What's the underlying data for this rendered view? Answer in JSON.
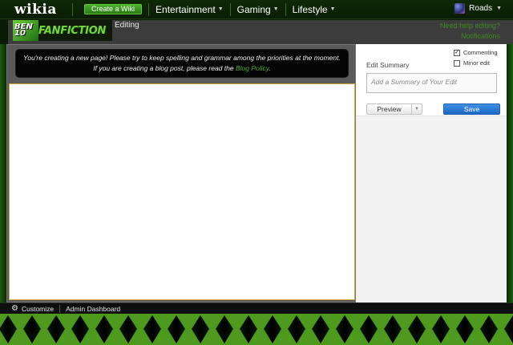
{
  "global_nav": {
    "logo": "wikia",
    "create_wiki": "Create a Wiki",
    "hubs": [
      {
        "label": "Entertainment"
      },
      {
        "label": "Gaming"
      },
      {
        "label": "Lifestyle"
      }
    ],
    "user": {
      "name": "Roads"
    }
  },
  "wiki_header": {
    "wordmark_badge": "BEN 10",
    "wordmark_text": "FANFICTION",
    "page_state": "Editing",
    "help_link": "Need help editing?",
    "notifications_link": "Notifications"
  },
  "editor": {
    "notice_text": "You're creating a new page! Please try to keep spelling and grammar among the priorities at the moment. If you are creating a blog post, please read the ",
    "notice_link": "Blog Policy",
    "notice_end": "."
  },
  "rail": {
    "commenting_label": "Commenting",
    "commenting_checked": true,
    "minor_edit_label": "Minor edit",
    "minor_edit_checked": false,
    "edit_summary_label": "Edit Summary",
    "summary_placeholder": "Add a Summary of Your Edit",
    "preview_label": "Preview",
    "save_label": "Save"
  },
  "toolbar": {
    "customize": "Customize",
    "admin_dashboard": "Admin Dashboard"
  },
  "colors": {
    "accent_green": "#4faa2a",
    "save_blue": "#1c69c6",
    "background_green": "#4d9a1f"
  },
  "icons": {
    "customize": "gear-icon",
    "dropdown": "chevron-down-icon"
  }
}
